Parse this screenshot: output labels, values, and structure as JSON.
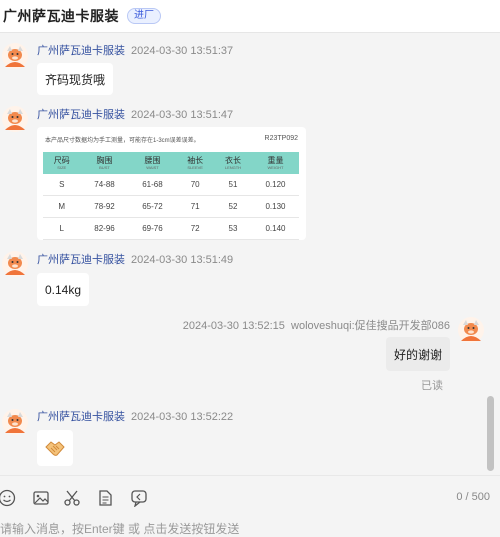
{
  "header": {
    "title": "广州萨瓦迪卡服装",
    "badge": "进厂"
  },
  "messages": {
    "m1": {
      "sender": "广州萨瓦迪卡服装",
      "time": "2024-03-30 13:51:37",
      "text": "齐码现货哦"
    },
    "m2": {
      "sender": "广州萨瓦迪卡服装",
      "time": "2024-03-30 13:51:47",
      "card": {
        "caption": "本产品尺寸数据均为手工测量，可能存在1-3cm误差误差。",
        "code": "R23TP092",
        "headers": [
          {
            "cn": "尺码",
            "en": "SIZE"
          },
          {
            "cn": "胸围",
            "en": "BUST"
          },
          {
            "cn": "腰围",
            "en": "WAIST"
          },
          {
            "cn": "袖长",
            "en": "SLEEVE"
          },
          {
            "cn": "衣长",
            "en": "LENGTH"
          },
          {
            "cn": "重量",
            "en": "WEIGHT"
          }
        ],
        "rows": [
          [
            "S",
            "74-88",
            "61-68",
            "70",
            "51",
            "0.120"
          ],
          [
            "M",
            "78-92",
            "65-72",
            "71",
            "52",
            "0.130"
          ],
          [
            "L",
            "82-96",
            "69-76",
            "72",
            "53",
            "0.140"
          ]
        ]
      }
    },
    "m3": {
      "sender": "广州萨瓦迪卡服装",
      "time": "2024-03-30 13:51:49",
      "text": "0.14kg"
    },
    "m4": {
      "time": "2024-03-30 13:52:15",
      "sender": "woloveshuqi:促佳搜品开发部086",
      "text": "好的谢谢",
      "status": "已读"
    },
    "m5": {
      "sender": "广州萨瓦迪卡服装",
      "time": "2024-03-30 13:52:22",
      "sticker": "handshake-emoji"
    }
  },
  "composer": {
    "counter": "0 / 500",
    "placeholder": "请输入消息，按Enter键 或 点击发送按钮发送",
    "tools": [
      "emoji-icon",
      "image-icon",
      "scissors-icon",
      "document-icon",
      "quick-reply-icon"
    ]
  },
  "colors": {
    "accent": "#3652a0",
    "table_header": "#83d6c8",
    "avatar": "#f0743a"
  }
}
